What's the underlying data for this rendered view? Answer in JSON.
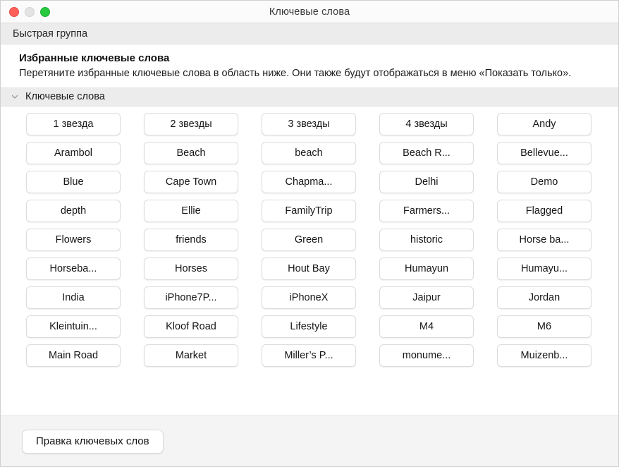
{
  "window": {
    "title": "Ключевые слова",
    "traffic_lights": [
      {
        "name": "close-button",
        "color": "#ff6159"
      },
      {
        "name": "minimize-button",
        "color": "#e4e4e4"
      },
      {
        "name": "maximize-button",
        "color": "#27c93f"
      }
    ]
  },
  "toolbar": {
    "quick_group_label": "Быстрая группа"
  },
  "favorites": {
    "heading": "Избранные ключевые слова",
    "description": "Перетяните избранные ключевые слова в область ниже. Они также будут отображаться в меню «Показать только»."
  },
  "section": {
    "label": "Ключевые слова",
    "chevron_icon": "chevron-down-icon",
    "expanded": true
  },
  "keywords": [
    "1 звезда",
    "2 звезды",
    "3 звезды",
    "4 звезды",
    "Andy",
    "Arambol",
    "Beach",
    "beach",
    "Beach R...",
    "Bellevue...",
    "Blue",
    "Cape Town",
    "Chapma...",
    "Delhi",
    "Demo",
    "depth",
    "Ellie",
    "FamilyTrip",
    "Farmers...",
    "Flagged",
    "Flowers",
    "friends",
    "Green",
    "historic",
    "Horse ba...",
    "Horseba...",
    "Horses",
    "Hout Bay",
    "Humayun",
    "Humayu...",
    "India",
    "iPhone7P...",
    "iPhoneX",
    "Jaipur",
    "Jordan",
    "Kleintuin...",
    "Kloof Road",
    "Lifestyle",
    "M4",
    "M6",
    "Main Road",
    "Market",
    "Miller’s P...",
    "monume...",
    "Muizenb..."
  ],
  "footer": {
    "edit_keywords_label": "Правка ключевых слов"
  },
  "colors": {
    "titlebar_bg": "#fbfbfb",
    "band_bg": "#ececec",
    "content_bg": "#ffffff",
    "footer_bg": "#f4f4f4",
    "chip_border": "#dcdcdc",
    "text": "#161616"
  }
}
